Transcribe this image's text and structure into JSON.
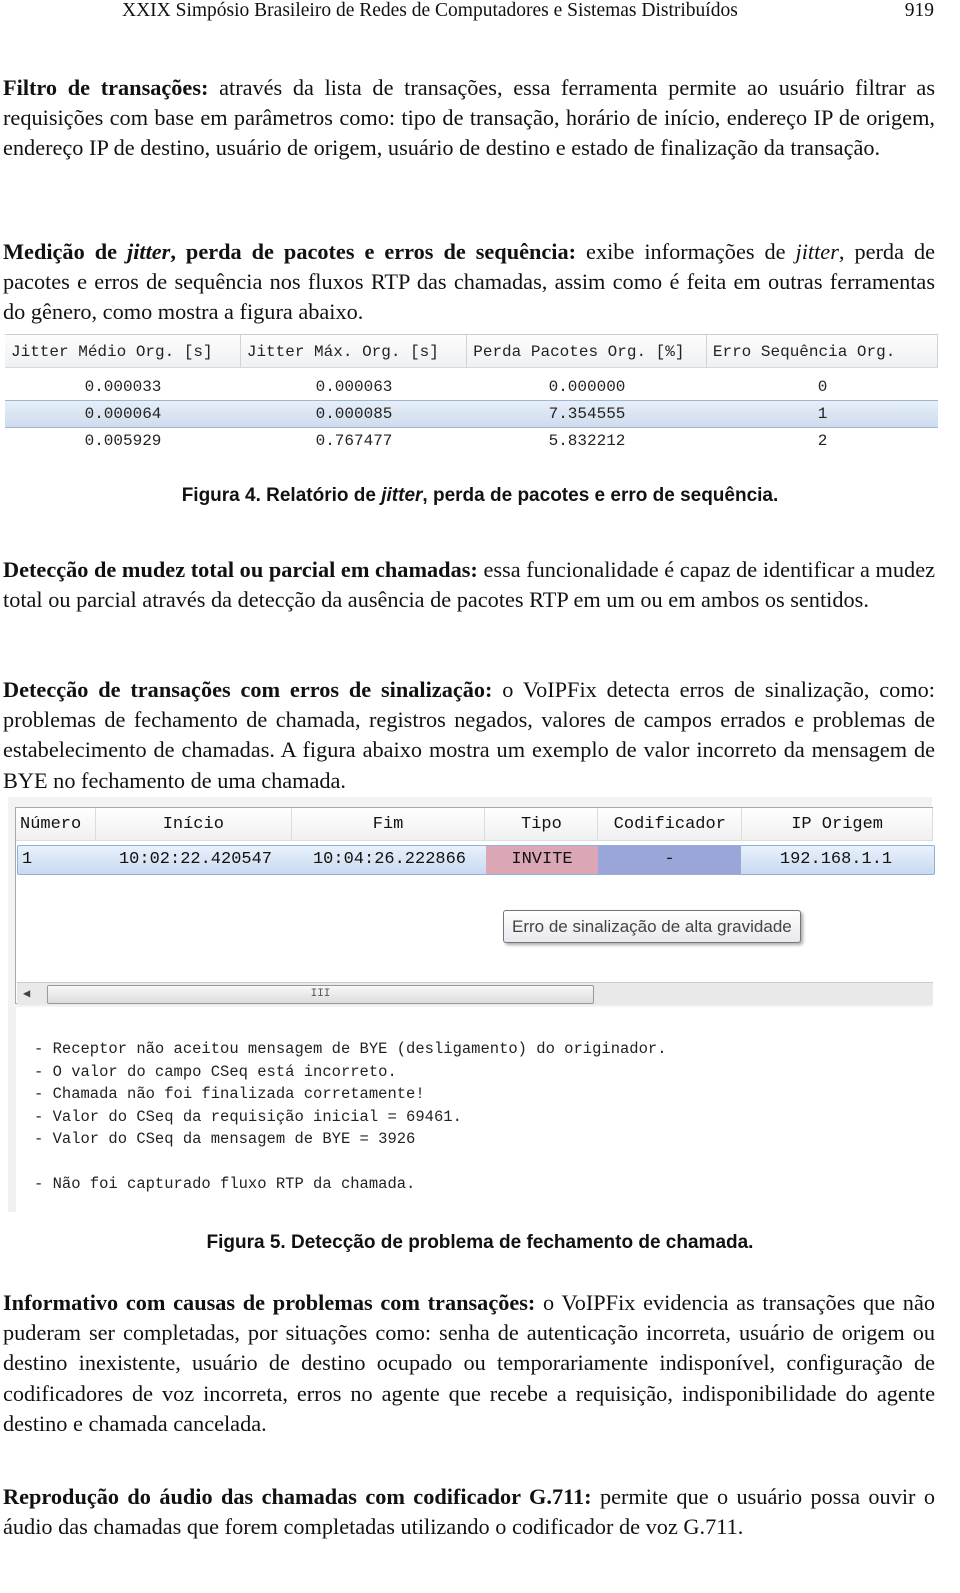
{
  "header": {
    "title": "XXIX Simpósio Brasileiro de Redes de Computadores e Sistemas Distribuídos",
    "page": "919"
  },
  "p1": {
    "lead": "Filtro de transações:",
    "text": " através da lista de transações, essa ferramenta permite ao usuário filtrar as requisições com base em parâmetros como: tipo de transação, horário de início, endereço IP de origem, endereço IP de destino, usuário de origem, usuário de destino e estado de finalização da transação."
  },
  "p2": {
    "lead_a": "Medição de ",
    "lead_i": "jitter",
    "lead_b": ", perda de pacotes e erros de sequência:",
    "text_a": " exibe informações de ",
    "text_i": "jitter",
    "text_b": ", perda de pacotes e erros de sequência nos fluxos RTP das chamadas, assim como é feita em outras ferramentas do gênero, como mostra a figura abaixo."
  },
  "figure4": {
    "columns": [
      "Jitter Médio Org. [s]",
      "Jitter Máx. Org. [s]",
      "Perda Pacotes Org. [%]",
      "Erro Sequência Org."
    ],
    "rows": [
      [
        "0.000033",
        "0.000063",
        "0.000000",
        "0"
      ],
      [
        "0.000064",
        "0.000085",
        "7.354555",
        "1"
      ],
      [
        "0.005929",
        "0.767477",
        "5.832212",
        "2"
      ]
    ],
    "selected_row": 1,
    "caption_a": "Figura 4. Relatório de ",
    "caption_i": "jitter",
    "caption_b": ", perda de pacotes e erro de sequência."
  },
  "p3": {
    "lead": "Detecção de mudez total ou parcial em chamadas:",
    "text": " essa funcionalidade é capaz de identificar a mudez total ou parcial através da detecção da ausência de pacotes RTP em um ou em ambos os sentidos."
  },
  "p4": {
    "lead": "Detecção de transações com erros de sinalização:",
    "text": " o VoIPFix detecta erros de sinalização, como: problemas de fechamento de chamada, registros negados, valores de campos errados e problemas de estabelecimento de chamadas. A figura abaixo mostra um exemplo de valor incorreto da mensagem de BYE no fechamento de uma chamada."
  },
  "figure5": {
    "columns": [
      "Número",
      "Início",
      "Fim",
      "Tipo",
      "Codificador",
      "IP Origem"
    ],
    "row": [
      "1",
      "10:02:22.420547",
      "10:04:26.222866",
      "INVITE",
      "-",
      "192.168.1.1"
    ],
    "colors": {
      "tipo_cell": "#dba7b5",
      "codificador_cell": "#9aa6d8",
      "row_selected": "#c8daf0"
    },
    "tooltip": "Erro de sinalização de alta gravidade",
    "scrollbar_grip": "III",
    "messages": [
      "- Receptor não aceitou mensagem de BYE (desligamento) do originador.",
      "- O valor do campo CSeq está incorreto.",
      "- Chamada não foi finalizada corretamente!",
      "- Valor do CSeq da requisição inicial = 69461.",
      "- Valor do CSeq da mensagem de BYE = 3926",
      "- Não foi capturado fluxo RTP da chamada."
    ],
    "caption": "Figura 5. Detecção de problema de fechamento de chamada."
  },
  "p5": {
    "lead": "Informativo com causas de problemas com transações:",
    "text": " o VoIPFix evidencia as transações que não puderam ser completadas, por situações como: senha de autenticação incorreta, usuário de origem ou destino inexistente, usuário de destino ocupado ou temporariamente indisponível, configuração de codificadores de voz incorreta, erros no agente que recebe a requisição, indisponibilidade do agente destino e chamada cancelada."
  },
  "p6": {
    "lead": "Reprodução do áudio das chamadas com codificador G.711:",
    "text": " permite que o usuário possa ouvir o áudio das chamadas que forem completadas utilizando o codificador de voz G.711."
  }
}
